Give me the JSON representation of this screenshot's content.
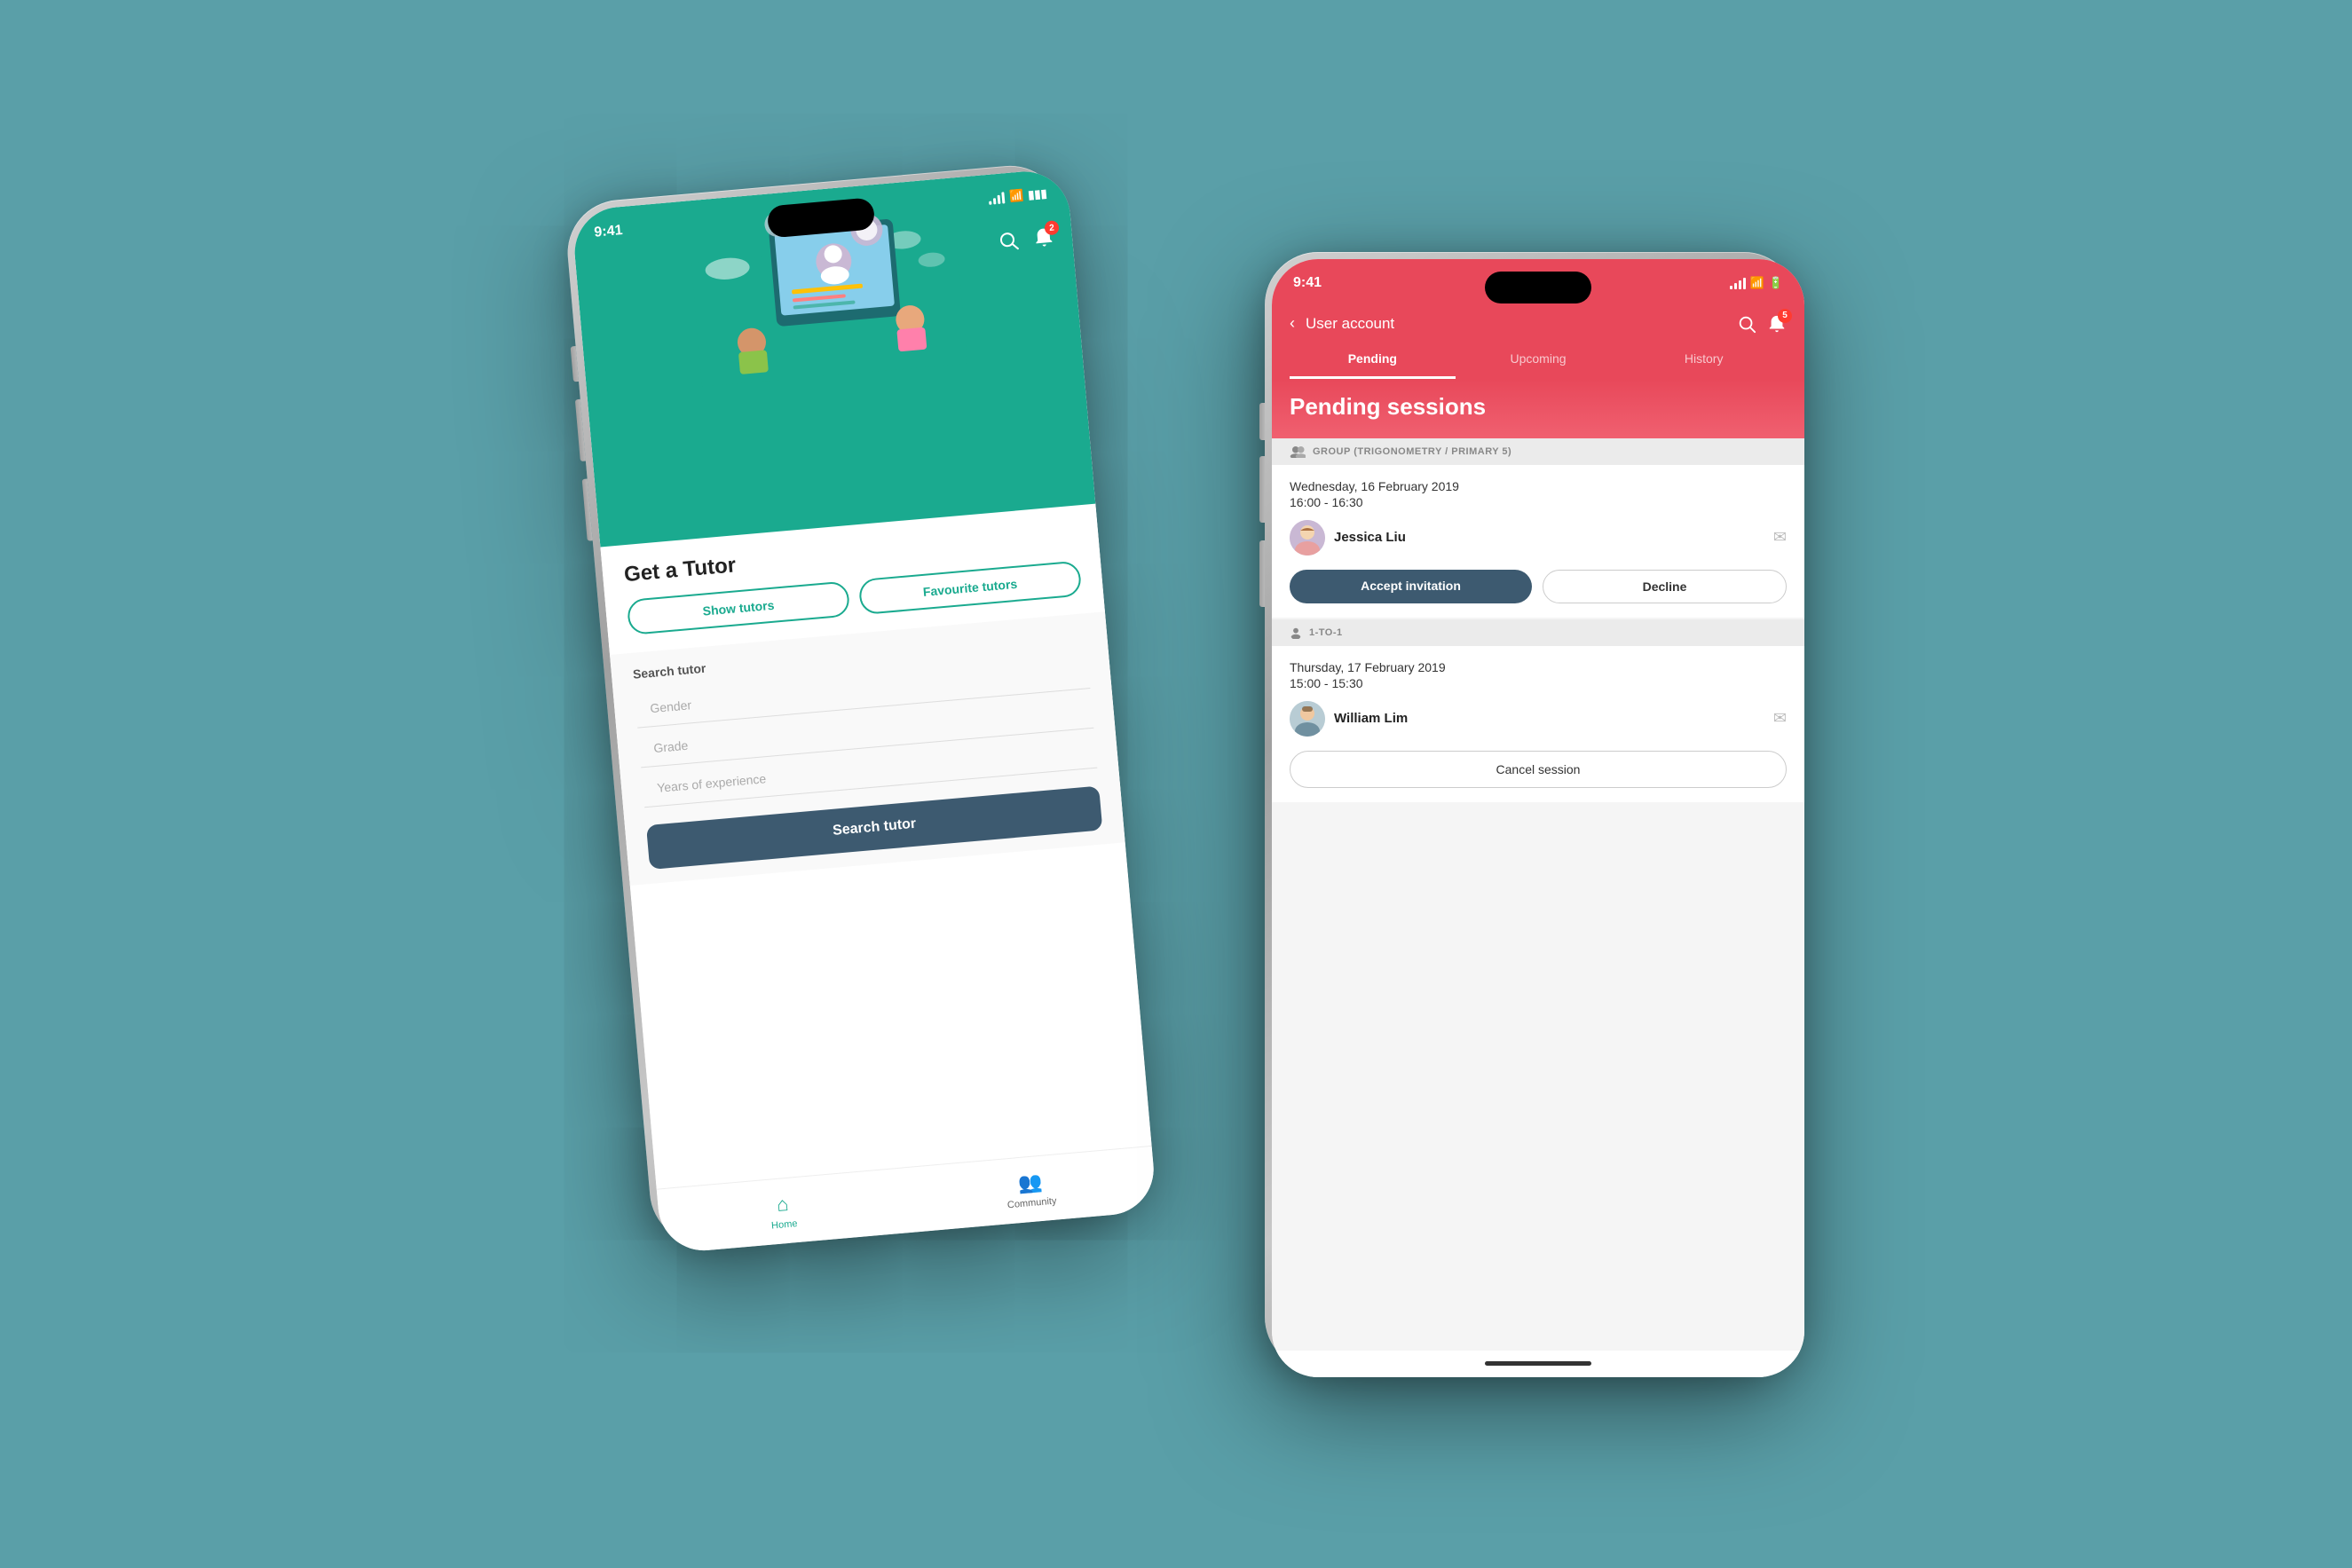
{
  "scene": {
    "background_color": "#5a9fa8"
  },
  "phone1": {
    "status_time": "9:41",
    "status_signal": "●●●",
    "status_wifi": "wifi",
    "status_battery": "battery",
    "app_title": "Get a Tutor",
    "show_tutors_btn": "Show tutors",
    "favourite_tutors_btn": "Favourite tutors",
    "search_label": "Search tutor",
    "gender_placeholder": "Gender",
    "grade_placeholder": "Grade",
    "experience_placeholder": "Years of experience",
    "search_button": "Search tutor",
    "nav_home": "Home",
    "nav_community": "Community",
    "notification_count": "2"
  },
  "phone2": {
    "status_time": "9:41",
    "status_signal": "●●●",
    "status_wifi": "wifi",
    "status_battery": "battery",
    "back_label": "User account",
    "tab_pending": "Pending",
    "tab_upcoming": "Upcoming",
    "tab_history": "History",
    "pending_title": "Pending sessions",
    "notification_count": "5",
    "group_label": "GROUP (TRIGONOMETRY / PRIMARY 5)",
    "session1_date": "Wednesday, 16 February 2019",
    "session1_time": "16:00 - 16:30",
    "session1_tutor": "Jessica Liu",
    "accept_btn": "Accept invitation",
    "decline_btn": "Decline",
    "group2_label": "1-TO-1",
    "session2_date": "Thursday, 17 February 2019",
    "session2_time": "15:00 - 15:30",
    "session2_tutor": "William Lim",
    "cancel_btn": "Cancel session"
  }
}
